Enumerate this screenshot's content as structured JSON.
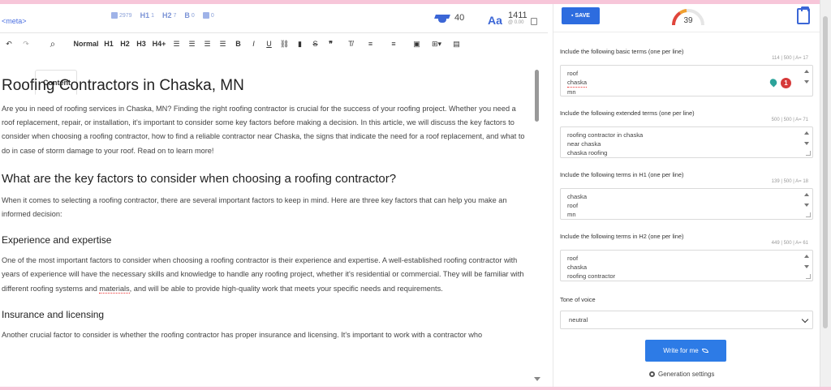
{
  "tabs": {
    "meta": "<meta>",
    "content": "Content"
  },
  "stats": {
    "words": "2979",
    "h1_label": "H1",
    "h1": "1",
    "h2_label": "H2",
    "h2": "7",
    "bold_label": "B",
    "bold": "0",
    "images": "0"
  },
  "cap_score": "40",
  "font_label": "Aa",
  "word_count": "1411",
  "word_count_sub": "@ 0.00",
  "toolbar": {
    "normal": "Normal",
    "h1": "H1",
    "h2": "H2",
    "h3": "H3",
    "h4": "H4+"
  },
  "article": {
    "title": "Roofing Contractors in Chaska, MN",
    "intro": "Are you in need of roofing services in Chaska, MN? Finding the right roofing contractor is crucial for the success of your roofing project. Whether you need a roof replacement, repair, or installation, it's important to consider some key factors before making a decision. In this article, we will discuss the key factors to consider when choosing a roofing contractor, how to find a reliable contractor near Chaska, the signs that indicate the need for a roof replacement, and what to do in case of storm damage to your roof. Read on to learn more!",
    "h2_1": "What are the key factors to consider when choosing a roofing contractor?",
    "p2": "When it comes to selecting a roofing contractor, there are several important factors to keep in mind. Here are three key factors that can help you make an informed decision:",
    "h3_1": "Experience and expertise",
    "p3_a": "One of the most important factors to consider when choosing a roofing contractor is their experience and expertise. A well-established roofing contractor with years of experience will have the necessary skills and knowledge to handle any roofing project, whether it's residential or commercial. They will be familiar with different roofing systems and ",
    "p3_word": "materials",
    "p3_b": ", and will be able to provide high-quality work that meets your specific needs and requirements.",
    "h3_2": "Insurance and licensing",
    "p4": "Another crucial factor to consider is whether the roofing contractor has proper insurance and licensing. It's important to work with a contractor who"
  },
  "panel": {
    "save": "SAVE",
    "score": "39",
    "basic": {
      "label": "Include the following basic terms (one per line)",
      "count": "114 | 500 | A= 17",
      "lines": [
        "roof",
        "chaska",
        "mn"
      ],
      "badge": "1"
    },
    "extended": {
      "label": "Include the following extended terms (one per line)",
      "count": "500 | 500 | A= 71",
      "lines": [
        "roofing contractor in chaska",
        "near chaska",
        "chaska roofing"
      ]
    },
    "h1terms": {
      "label": "Include the following terms in H1 (one per line)",
      "count": "139 | 500 | A= 18",
      "lines": [
        "chaska",
        "roof",
        "mn"
      ]
    },
    "h2terms": {
      "label": "Include the following terms in H2 (one per line)",
      "count": "449 | 500 | A= 61",
      "lines": [
        "roof",
        "chaska",
        "roofing contractor"
      ]
    },
    "tone_label": "Tone of voice",
    "tone_value": "neutral",
    "write": "Write for me",
    "gen_settings": "Generation settings"
  },
  "colors": {
    "accent": "#2d6cdf",
    "frame": "#f7c6d9",
    "badge": "#d63a3a"
  }
}
